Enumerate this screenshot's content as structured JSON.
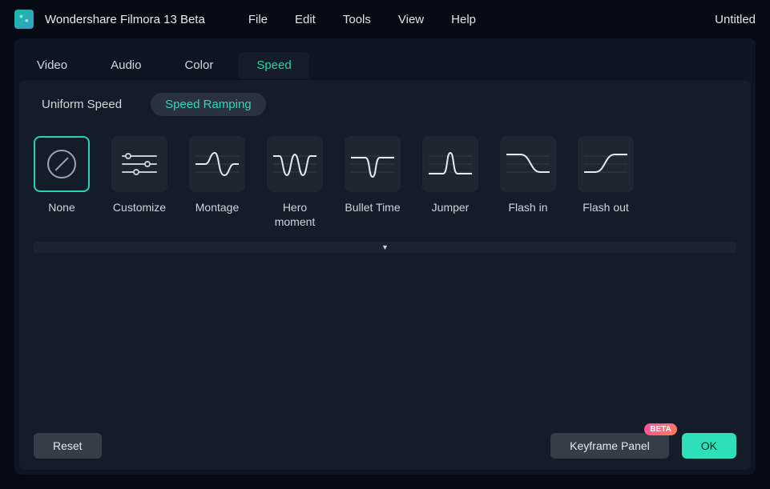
{
  "app": {
    "title": "Wondershare Filmora 13 Beta"
  },
  "menu": {
    "file": "File",
    "edit": "Edit",
    "tools": "Tools",
    "view": "View",
    "help": "Help"
  },
  "project": {
    "name": "Untitled"
  },
  "tabs": {
    "video": "Video",
    "audio": "Audio",
    "color": "Color",
    "speed": "Speed",
    "active": "speed"
  },
  "speed_modes": {
    "uniform": "Uniform Speed",
    "ramping": "Speed Ramping",
    "active": "ramping"
  },
  "presets": [
    {
      "id": "none",
      "label": "None",
      "selected": true
    },
    {
      "id": "customize",
      "label": "Customize",
      "selected": false
    },
    {
      "id": "montage",
      "label": "Montage",
      "selected": false
    },
    {
      "id": "hero",
      "label": "Hero moment",
      "selected": false
    },
    {
      "id": "bullet",
      "label": "Bullet Time",
      "selected": false
    },
    {
      "id": "jumper",
      "label": "Jumper",
      "selected": false
    },
    {
      "id": "flashin",
      "label": "Flash in",
      "selected": false
    },
    {
      "id": "flashout",
      "label": "Flash out",
      "selected": false
    }
  ],
  "footer": {
    "reset": "Reset",
    "keyframe_panel": "Keyframe Panel",
    "beta_badge": "BETA",
    "ok": "OK"
  },
  "colors": {
    "accent": "#25d3b3",
    "panel": "#141c29",
    "tile": "#1e2632"
  }
}
